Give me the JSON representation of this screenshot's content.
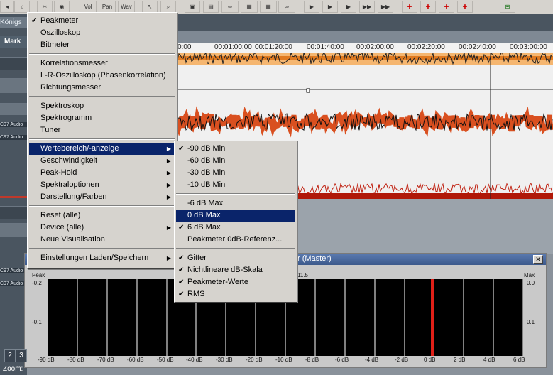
{
  "window": {
    "title_fragment": "Königs"
  },
  "toolbar": {
    "vol_label": "Vol",
    "pan_label": "Pan",
    "wav_label": "Wav",
    "mark_tab": "Mark"
  },
  "tracks": {
    "audio_label": "C97 Audio"
  },
  "ruler": {
    "labels": [
      "0:00",
      "00:01:00:00",
      "00:01:20:00",
      "00:01:40:00",
      "00:02:00:00",
      "00:02:20:00",
      "00:02:40:00",
      "00:03:00:00"
    ]
  },
  "menu": {
    "items": [
      {
        "label": "Peakmeter",
        "checked": true
      },
      {
        "label": "Oszilloskop"
      },
      {
        "label": "Bitmeter"
      },
      {
        "label": "Korrelationsmesser"
      },
      {
        "label": "L-R-Oszilloskop (Phasenkorrelation)"
      },
      {
        "label": "Richtungsmesser"
      },
      {
        "label": "Spektroskop"
      },
      {
        "label": "Spektrogramm"
      },
      {
        "label": "Tuner"
      },
      {
        "label": "Wertebereich/-anzeige",
        "submenu": true,
        "selected": true
      },
      {
        "label": "Geschwindigkeit",
        "submenu": true
      },
      {
        "label": "Peak-Hold",
        "submenu": true
      },
      {
        "label": "Spektraloptionen",
        "submenu": true
      },
      {
        "label": "Darstellung/Farben",
        "submenu": true
      },
      {
        "label": "Reset (alle)"
      },
      {
        "label": "Device (alle)",
        "submenu": true
      },
      {
        "label": "Neue Visualisation"
      },
      {
        "label": "Einstellungen Laden/Speichern",
        "submenu": true
      }
    ]
  },
  "submenu": {
    "items": [
      {
        "label": "-90 dB Min",
        "checked": true
      },
      {
        "label": "-60 dB Min"
      },
      {
        "label": "-30 dB Min"
      },
      {
        "label": "-10 dB Min"
      },
      {
        "label": "-6 dB Max"
      },
      {
        "label": "0 dB Max",
        "selected": true
      },
      {
        "label": "6 dB Max",
        "checked": true
      },
      {
        "label": "Peakmeter 0dB-Referenz..."
      },
      {
        "label": "Gitter",
        "checked": true
      },
      {
        "label": "Nichtlineare dB-Skala",
        "checked": true
      },
      {
        "label": "Peakmeter-Werte",
        "checked": true
      },
      {
        "label": "RMS",
        "checked": true
      }
    ]
  },
  "meter": {
    "title": "r (Master)",
    "peak_label": "Peak",
    "max_label": "Max",
    "left_vals": [
      "-0.2",
      "-0.1"
    ],
    "right_vals": [
      "0.0",
      "0.1"
    ],
    "small_val": "11.5",
    "scale": [
      "-90 dB",
      "-80 dB",
      "-70 dB",
      "-60 dB",
      "-50 dB",
      "-40 dB",
      "-30 dB",
      "-20 dB",
      "-10 dB",
      "-8 dB",
      "-6 dB",
      "-4 dB",
      "-2 dB",
      "0 dB",
      "2 dB",
      "4 dB",
      "6 dB"
    ],
    "colors": {
      "bar": "#e02018",
      "plot_bg": "#000000",
      "grid": "#ffffff"
    }
  },
  "bottom": {
    "tabs": [
      "2",
      "3"
    ],
    "zoom_label": "Zoom:"
  }
}
